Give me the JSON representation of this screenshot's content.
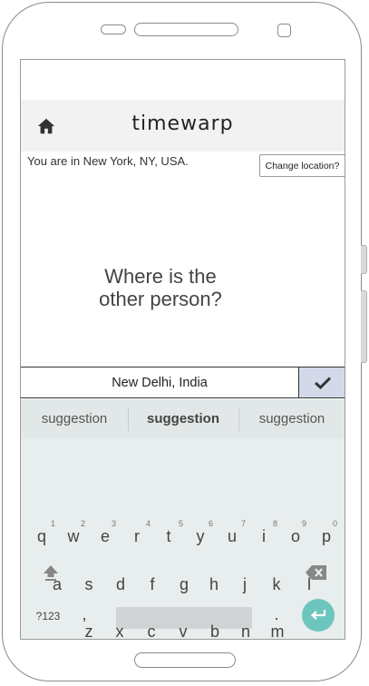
{
  "app": {
    "title": "timewarp",
    "location_text": "You are in New York, NY, USA.",
    "change_location_label": "Change location?",
    "question_line1": "Where is the",
    "question_line2": "other person?",
    "input_value": "New Delhi, India"
  },
  "keyboard": {
    "suggestions": [
      "suggestion",
      "suggestion",
      "suggestion"
    ],
    "row1": [
      "q",
      "w",
      "e",
      "r",
      "t",
      "y",
      "u",
      "i",
      "o",
      "p"
    ],
    "row1_numbers": [
      "1",
      "2",
      "3",
      "4",
      "5",
      "6",
      "7",
      "8",
      "9",
      "0"
    ],
    "row2": [
      "a",
      "s",
      "d",
      "f",
      "g",
      "h",
      "j",
      "k",
      "l"
    ],
    "row3": [
      "z",
      "x",
      "c",
      "v",
      "b",
      "n",
      "m"
    ],
    "symbols_label": "?123",
    "comma": ",",
    "period": "."
  },
  "colors": {
    "header_bg": "#f2f2f2",
    "confirm_bg": "#d3d9e8",
    "enter_key": "#6cc6bd",
    "keyboard_bg": "#e8eded"
  },
  "icons": [
    "home-icon",
    "checkmark-icon",
    "shift-icon",
    "backspace-icon",
    "enter-icon"
  ]
}
